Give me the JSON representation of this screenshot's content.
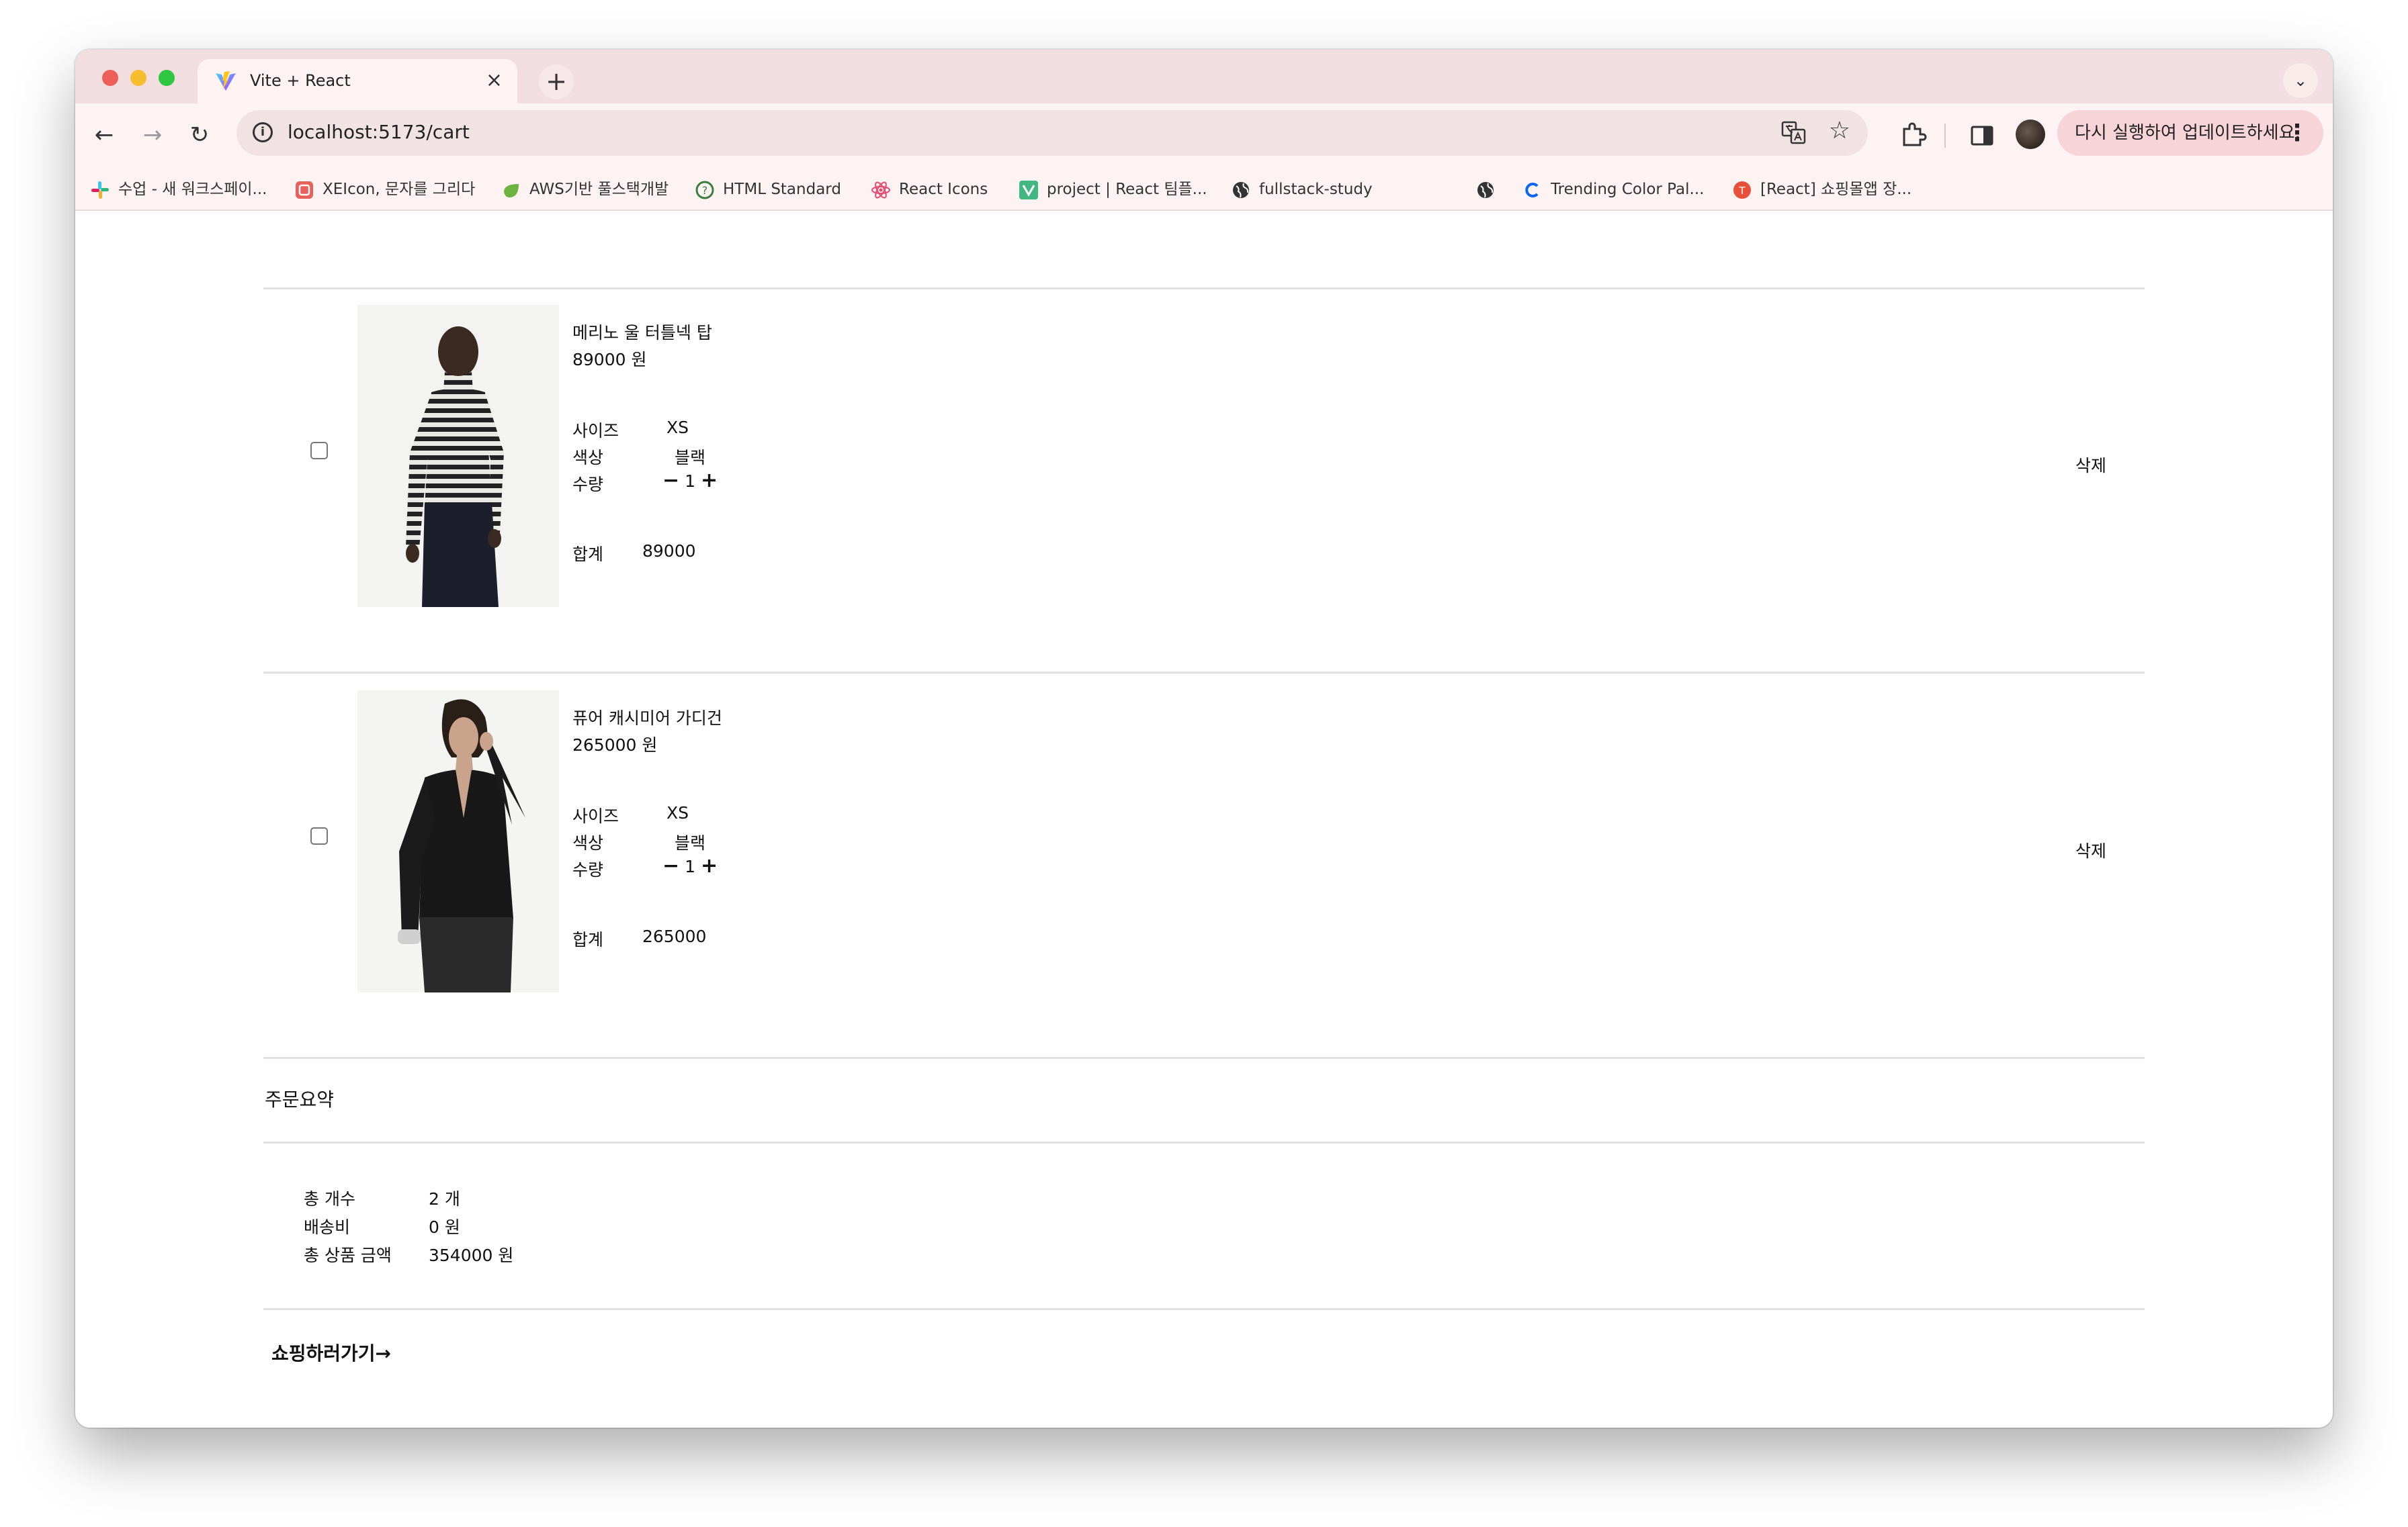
{
  "browser": {
    "tab_title": "Vite + React",
    "tab_close": "×",
    "new_tab": "+",
    "tab_menu": "⌄",
    "url": "localhost:5173/cart",
    "update_button": "다시 실행하여 업데이트하세요.",
    "update_menu": "⋮",
    "nav_back": "←",
    "nav_forward": "→",
    "nav_reload": "↻",
    "bookmark_star": "☆",
    "info": "i"
  },
  "bookmarks": [
    {
      "label": "수업 - 새 워크스페이...",
      "icon": "slack-icon",
      "color": "#e01e5a"
    },
    {
      "label": "XEIcon, 문자를 그리다",
      "icon": "xeicon-icon",
      "color": "#e8605a"
    },
    {
      "label": "AWS기반 풀스택개발",
      "icon": "leaf-icon",
      "color": "#6db33f"
    },
    {
      "label": "HTML Standard",
      "icon": "whatwg-icon",
      "color": "#3c7c3c"
    },
    {
      "label": "React Icons",
      "icon": "react-icon",
      "color": "#e5466f"
    },
    {
      "label": "project | React 팀플...",
      "icon": "vue-icon",
      "color": "#41b883"
    },
    {
      "label": "fullstack-study",
      "icon": "globe-icon",
      "color": "#333333"
    },
    {
      "label": "",
      "icon": "globe-icon",
      "color": "#333333"
    },
    {
      "label": "Trending Color Pal...",
      "icon": "coolors-icon",
      "color": "#0a64f6"
    },
    {
      "label": "[React] 쇼핑몰앱 장...",
      "icon": "notion-icon",
      "color": "#e8503a"
    }
  ],
  "cart": {
    "labels": {
      "size": "사이즈",
      "color": "색상",
      "quantity": "수량",
      "total": "합계",
      "minus": "−",
      "plus": "+",
      "delete": "삭제"
    },
    "items": [
      {
        "name": "메리노 울 터틀넥 탑",
        "price": "89000 원",
        "size": "XS",
        "color": "블랙",
        "quantity": "1",
        "total": "89000",
        "image": "striped-turtleneck-photo"
      },
      {
        "name": "퓨어 캐시미어 가디건",
        "price": "265000 원",
        "size": "XS",
        "color": "블랙",
        "quantity": "1",
        "total": "265000",
        "image": "black-cardigan-photo"
      }
    ]
  },
  "summary": {
    "title": "주문요약",
    "count_label": "총 개수",
    "count_value": "2 개",
    "shipping_label": "배송비",
    "shipping_value": "0 원",
    "total_label": "총 상품 금액",
    "total_value": "354000 원"
  },
  "shop_link": "쇼핑하러가기→"
}
